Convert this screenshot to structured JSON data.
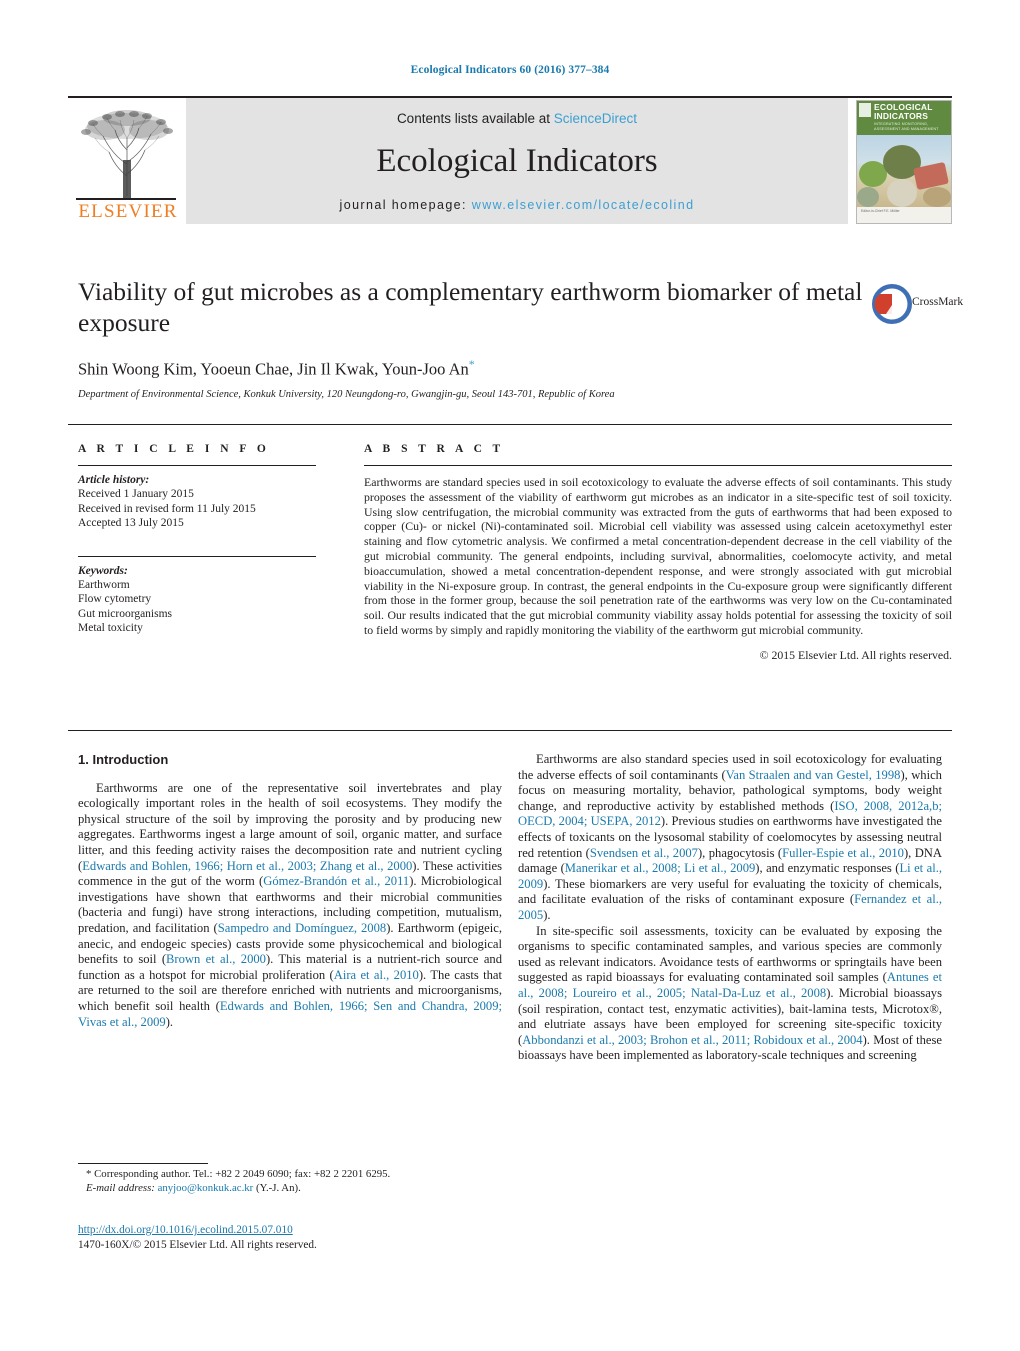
{
  "running_head": "Ecological Indicators 60 (2016) 377–384",
  "masthead": {
    "publisher_wordmark": "ELSEVIER",
    "contents_prefix": "Contents lists available at ",
    "contents_link": "ScienceDirect",
    "journal_name": "Ecological Indicators",
    "homepage_prefix": "journal homepage: ",
    "homepage_url": "www.elsevier.com/locate/ecolind",
    "cover": {
      "title_line1": "ECOLOGICAL",
      "title_line2": "INDICATORS",
      "subtitle": "INTEGRATING MONITORING, ASSESSMENT AND MANAGEMENT",
      "footer": "Editor-in-Chief\nF.E. Müller"
    },
    "accent_link_color": "#3d9fd1",
    "elsevier_orange": "#ef7d22",
    "panel_gray": "#e3e3e3"
  },
  "article": {
    "title": "Viability of gut microbes as a complementary earthworm biomarker of metal exposure",
    "authors": "Shin Woong Kim, Yooeun Chae, Jin Il Kwak, Youn-Joo An",
    "corresponding_marker": "*",
    "affiliation": "Department of Environmental Science, Konkuk University, 120 Neungdong-ro, Gwangjin-gu, Seoul 143-701, Republic of Korea",
    "crossmark_label": "CrossMark"
  },
  "info": {
    "heading": "A R T I C L E   I N F O",
    "history_label": "Article history:",
    "history": [
      "Received 1 January 2015",
      "Received in revised form 11 July 2015",
      "Accepted 13 July 2015"
    ],
    "keywords_label": "Keywords:",
    "keywords": [
      "Earthworm",
      "Flow cytometry",
      "Gut microorganisms",
      "Metal toxicity"
    ]
  },
  "abstract": {
    "heading": "A B S T R A C T",
    "text": "Earthworms are standard species used in soil ecotoxicology to evaluate the adverse effects of soil contaminants. This study proposes the assessment of the viability of earthworm gut microbes as an indicator in a site-specific test of soil toxicity. Using slow centrifugation, the microbial community was extracted from the guts of earthworms that had been exposed to copper (Cu)- or nickel (Ni)-contaminated soil. Microbial cell viability was assessed using calcein acetoxymethyl ester staining and flow cytometric analysis. We confirmed a metal concentration-dependent decrease in the cell viability of the gut microbial community. The general endpoints, including survival, abnormalities, coelomocyte activity, and metal bioaccumulation, showed a metal concentration-dependent response, and were strongly associated with gut microbial viability in the Ni-exposure group. In contrast, the general endpoints in the Cu-exposure group were significantly different from those in the former group, because the soil penetration rate of the earthworms was very low on the Cu-contaminated soil. Our results indicated that the gut microbial community viability assay holds potential for assessing the toxicity of soil to field worms by simply and rapidly monitoring the viability of the earthworm gut microbial community.",
    "copyright": "© 2015 Elsevier Ltd. All rights reserved."
  },
  "body": {
    "section_heading": "1. Introduction",
    "left_column": [
      {
        "segments": [
          {
            "t": "Earthworms are one of the representative soil invertebrates and play ecologically important roles in the health of soil ecosystems. They modify the physical structure of the soil by improving the porosity and by producing new aggregates. Earthworms ingest a large amount of soil, organic matter, and surface litter, and this feeding activity raises the decomposition rate and nutrient cycling (",
            "ref": false
          },
          {
            "t": "Edwards and Bohlen, 1966; Horn et al., 2003; Zhang et al., 2000",
            "ref": true
          },
          {
            "t": "). These activities commence in the gut of the worm (",
            "ref": false
          },
          {
            "t": "Gómez-Brandón et al., 2011",
            "ref": true
          },
          {
            "t": "). Microbiological investigations have shown that earthworms and their microbial communities (bacteria and fungi) have strong interactions, including competition, mutualism, predation, and facilitation (",
            "ref": false
          },
          {
            "t": "Sampedro and Domínguez, 2008",
            "ref": true
          },
          {
            "t": "). Earthworm (epigeic, anecic, and endogeic species) casts provide some physicochemical and biological benefits to soil (",
            "ref": false
          },
          {
            "t": "Brown et al., 2000",
            "ref": true
          },
          {
            "t": "). This material is a nutrient-rich source and function as a hotspot for microbial proliferation (",
            "ref": false
          },
          {
            "t": "Aira et al., 2010",
            "ref": true
          },
          {
            "t": "). The casts that are returned to the soil are therefore enriched with nutrients and microorganisms, which benefit soil health (",
            "ref": false
          },
          {
            "t": "Edwards and Bohlen, 1966; Sen and Chandra, 2009; Vivas et al., 2009",
            "ref": true
          },
          {
            "t": ").",
            "ref": false
          }
        ]
      }
    ],
    "right_column": [
      {
        "segments": [
          {
            "t": "Earthworms are also standard species used in soil ecotoxicology for evaluating the adverse effects of soil contaminants (",
            "ref": false
          },
          {
            "t": "Van Straalen and van Gestel, 1998",
            "ref": true
          },
          {
            "t": "), which focus on measuring mortality, behavior, pathological symptoms, body weight change, and reproductive activity by established methods (",
            "ref": false
          },
          {
            "t": "ISO, 2008, 2012a,b; OECD, 2004; USEPA, 2012",
            "ref": true
          },
          {
            "t": "). Previous studies on earthworms have investigated the effects of toxicants on the lysosomal stability of coelomocytes by assessing neutral red retention (",
            "ref": false
          },
          {
            "t": "Svendsen et al., 2007",
            "ref": true
          },
          {
            "t": "), phagocytosis (",
            "ref": false
          },
          {
            "t": "Fuller-Espie et al., 2010",
            "ref": true
          },
          {
            "t": "), DNA damage (",
            "ref": false
          },
          {
            "t": "Manerikar et al., 2008; Li et al., 2009",
            "ref": true
          },
          {
            "t": "), and enzymatic responses (",
            "ref": false
          },
          {
            "t": "Li et al., 2009",
            "ref": true
          },
          {
            "t": "). These biomarkers are very useful for evaluating the toxicity of chemicals, and facilitate evaluation of the risks of contaminant exposure (",
            "ref": false
          },
          {
            "t": "Fernandez et al., 2005",
            "ref": true
          },
          {
            "t": ").",
            "ref": false
          }
        ]
      },
      {
        "segments": [
          {
            "t": "In site-specific soil assessments, toxicity can be evaluated by exposing the organisms to specific contaminated samples, and various species are commonly used as relevant indicators. Avoidance tests of earthworms or springtails have been suggested as rapid bioassays for evaluating contaminated soil samples (",
            "ref": false
          },
          {
            "t": "Antunes et al., 2008; Loureiro et al., 2005; Natal-Da-Luz et al., 2008",
            "ref": true
          },
          {
            "t": "). Microbial bioassays (soil respiration, contact test, enzymatic activities), bait-lamina tests, Microtox®, and elutriate assays have been employed for screening site-specific toxicity (",
            "ref": false
          },
          {
            "t": "Abbondanzi et al., 2003; Brohon et al., 2011; Robidoux et al., 2004",
            "ref": true
          },
          {
            "t": "). Most of these bioassays have been implemented as laboratory-scale techniques and screening",
            "ref": false
          }
        ]
      }
    ]
  },
  "footnotes": {
    "corresponding": "* Corresponding author. Tel.: +82 2 2049 6090; fax: +82 2 2201 6295.",
    "email_label": "E-mail address:",
    "email": "anyjoo@konkuk.ac.kr",
    "email_suffix": "(Y.-J. An).",
    "doi": "http://dx.doi.org/10.1016/j.ecolind.2015.07.010",
    "issn_line": "1470-160X/© 2015 Elsevier Ltd. All rights reserved."
  }
}
